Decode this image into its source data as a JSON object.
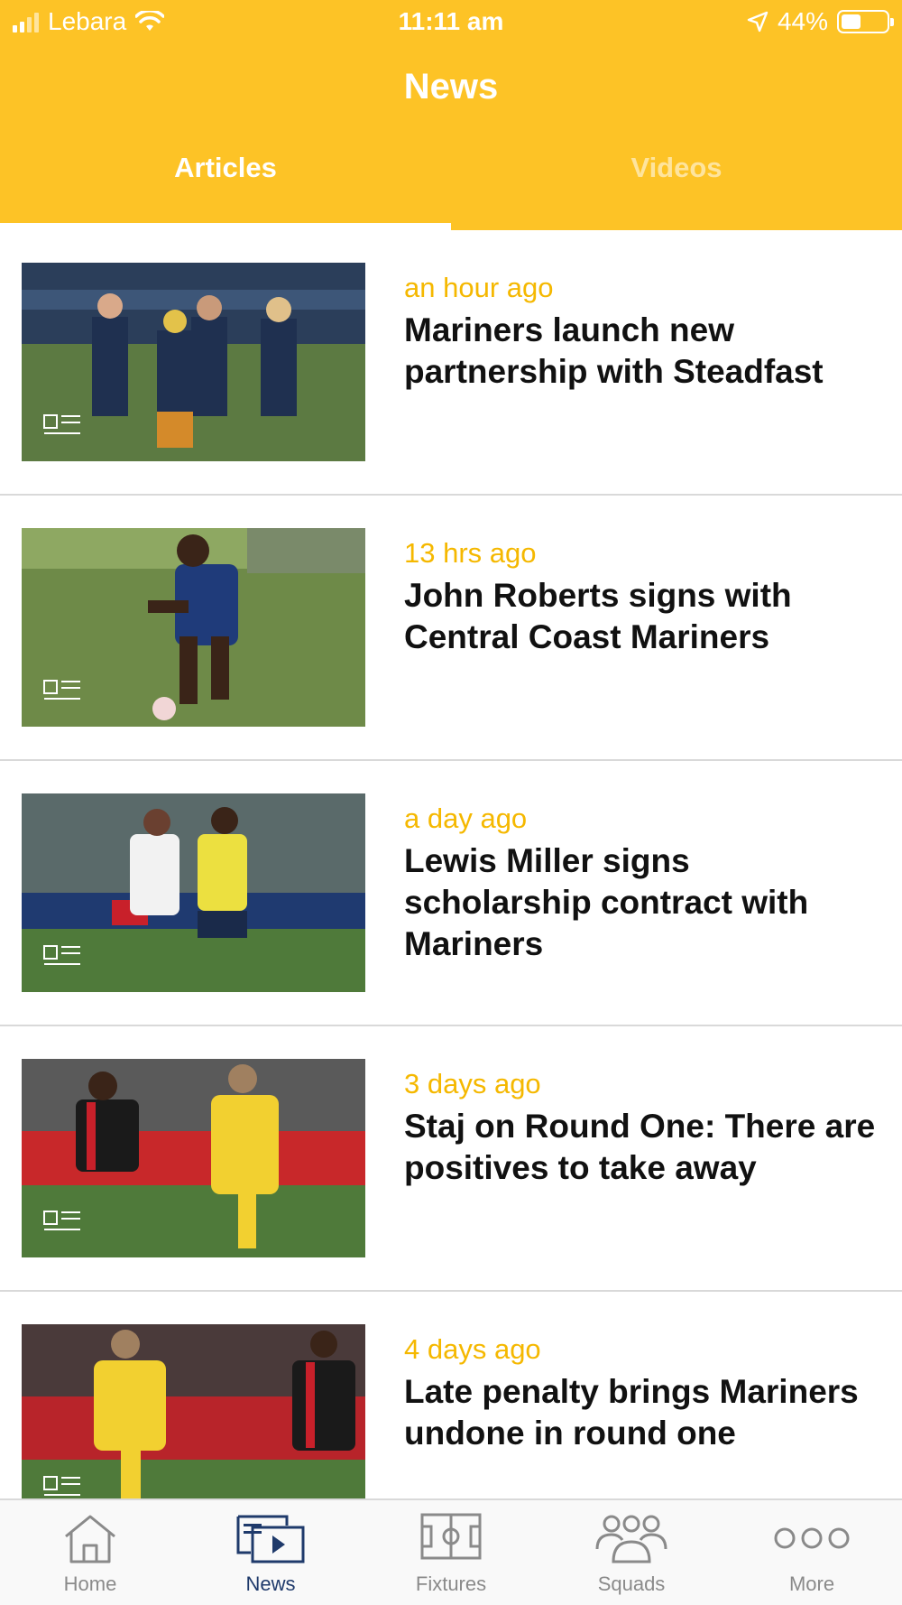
{
  "status_bar": {
    "carrier": "Lebara",
    "time": "11:11 am",
    "battery": "44%",
    "battery_level": 0.44
  },
  "header": {
    "title": "News",
    "tabs": [
      {
        "label": "Articles",
        "active": true
      },
      {
        "label": "Videos",
        "active": false
      }
    ]
  },
  "articles": [
    {
      "time": "an hour ago",
      "headline": "Mariners launch new partnership with Steadfast"
    },
    {
      "time": "13 hrs ago",
      "headline": "John Roberts signs with Central Coast Mariners"
    },
    {
      "time": "a day ago",
      "headline": "Lewis Miller signs scholarship contract with Mariners"
    },
    {
      "time": "3 days ago",
      "headline": "Staj on Round One: There are positives to take away"
    },
    {
      "time": "4 days ago",
      "headline": "Late penalty brings Mariners undone in round one"
    }
  ],
  "tabbar": [
    {
      "label": "Home",
      "icon": "home-icon",
      "active": false
    },
    {
      "label": "News",
      "icon": "news-icon",
      "active": true
    },
    {
      "label": "Fixtures",
      "icon": "pitch-icon",
      "active": false
    },
    {
      "label": "Squads",
      "icon": "people-icon",
      "active": false
    },
    {
      "label": "More",
      "icon": "more-icon",
      "active": false
    }
  ],
  "colors": {
    "brand_yellow": "#FDC326",
    "time_yellow": "#F5B800",
    "active_navy": "#1f3a6b"
  }
}
